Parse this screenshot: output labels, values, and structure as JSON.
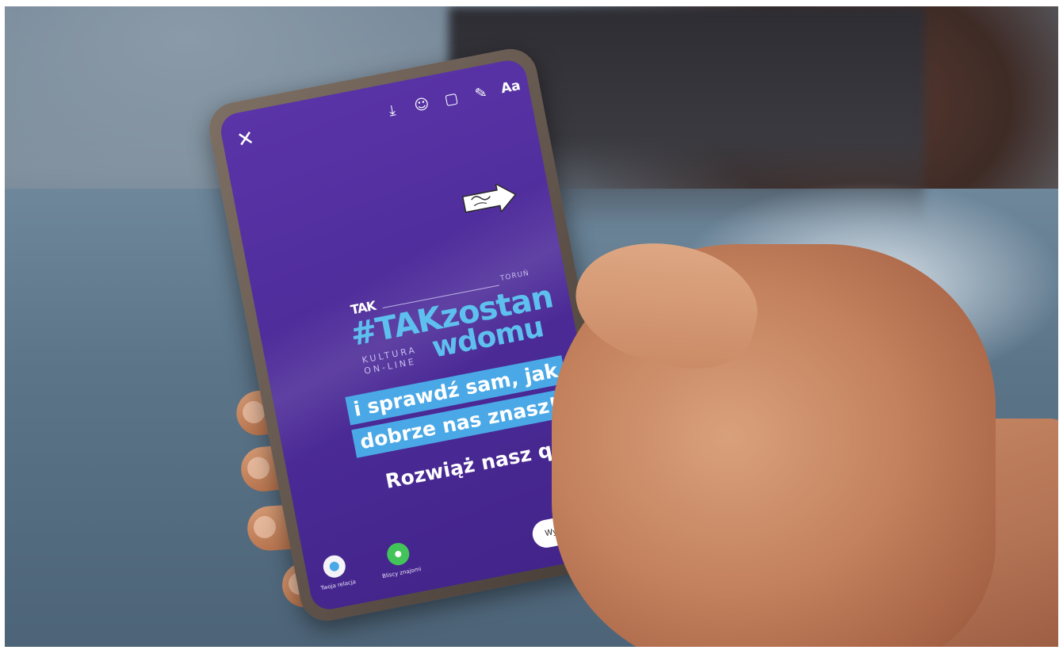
{
  "scene": {
    "description_icons": [
      "close-icon",
      "download-icon",
      "emoji-icon",
      "sticker-icon",
      "draw-icon"
    ]
  },
  "story": {
    "toolbar": {
      "close_glyph": "✕",
      "download_glyph": "⤓",
      "emoji_glyph": "☺",
      "sticker_glyph": "▢",
      "draw_glyph": "✎",
      "text_label": "Aa"
    },
    "brand": {
      "logo": "TAK",
      "city": "TORUŃ"
    },
    "hashtag": "#TAKzostan",
    "kultura_line1": "KULTURA",
    "kultura_line2": "ON-LINE",
    "wdomu": "wdomu",
    "highlight_lines": [
      "i sprawdź sam, jak",
      "dobrze nas znasz!"
    ],
    "quiz": "Rozwiąż nasz quiz!",
    "bottom_buttons": [
      {
        "label": "Twoja relacja"
      },
      {
        "label": "Bliscy znajomi"
      }
    ],
    "send_label": "Wyślij do",
    "colors": {
      "screen": "#4f2d9b",
      "accent": "#5ec0ee",
      "highlight": "#4aa8e6",
      "green": "#43c45a"
    }
  }
}
